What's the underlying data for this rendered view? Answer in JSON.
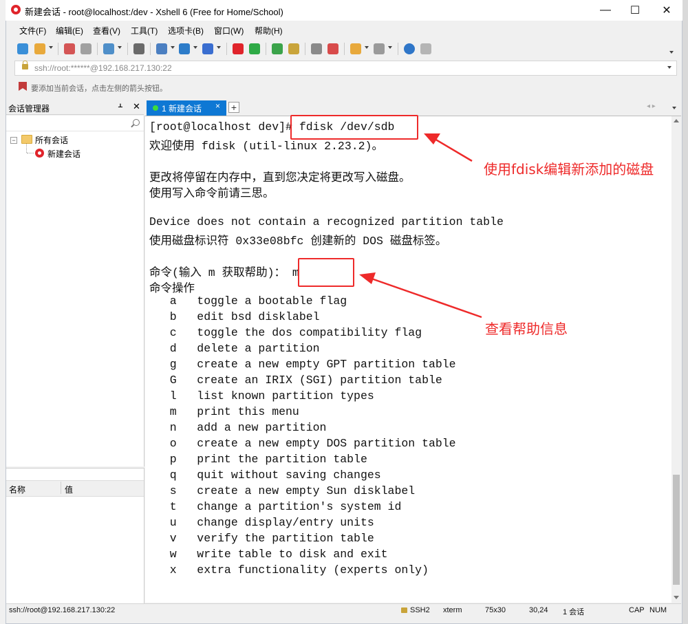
{
  "window": {
    "title": "新建会话 - root@localhost:/dev - Xshell 6 (Free for Home/School)",
    "minimize": "—",
    "maximize": "☐",
    "close": "✕"
  },
  "menu": [
    "文件(F)",
    "编辑(E)",
    "查看(V)",
    "工具(T)",
    "选项卡(B)",
    "窗口(W)",
    "帮助(H)"
  ],
  "toolbar_icons": [
    {
      "name": "new-session-icon",
      "color": "#3a8fd8"
    },
    {
      "name": "open-folder-icon",
      "color": "#e8a93c"
    },
    {
      "name": "connect-icon",
      "color": "#d45555"
    },
    {
      "name": "disconnect-icon",
      "color": "#a0a0a0"
    },
    {
      "name": "properties-icon",
      "color": "#4f8fc9"
    },
    {
      "name": "find-icon",
      "color": "#6a6a6a"
    },
    {
      "name": "transfer-icon",
      "color": "#4b7fc1"
    },
    {
      "name": "globe-icon",
      "color": "#2d7cc9"
    },
    {
      "name": "font-icon",
      "color": "#3a6ed0"
    },
    {
      "name": "xshell-icon",
      "color": "#e0242b"
    },
    {
      "name": "xftp-icon",
      "color": "#2eaa46"
    },
    {
      "name": "fullscreen-icon",
      "color": "#3ba34a"
    },
    {
      "name": "lock-icon",
      "color": "#c9a43a"
    },
    {
      "name": "keyboard-icon",
      "color": "#8a8a8a"
    },
    {
      "name": "highlight-icon",
      "color": "#d84b4b"
    },
    {
      "name": "new-tab-icon",
      "color": "#e8a93c"
    },
    {
      "name": "layout-icon",
      "color": "#9a9a9a"
    },
    {
      "name": "help-icon",
      "color": "#2f76c8"
    },
    {
      "name": "chat-icon",
      "color": "#b5b5b5"
    }
  ],
  "address": {
    "value": "ssh://root:******@192.168.217.130:22"
  },
  "hint": "要添加当前会话，点击左侧的箭头按钮。",
  "session_manager": {
    "title": "会话管理器",
    "pin": "ᚆ",
    "close": "✕",
    "tree_root": "所有会话",
    "tree_expander": "−",
    "tree_child": "新建会话"
  },
  "properties": {
    "col_name": "名称",
    "col_value": "值"
  },
  "tab": {
    "label": "1 新建会话",
    "close": "×",
    "add": "+",
    "nav": "◂ ▸"
  },
  "terminal_lines": [
    "[root@localhost dev]# fdisk /dev/sdb",
    "欢迎使用 fdisk (util-linux 2.23.2)。",
    "",
    "更改将停留在内存中，直到您决定将更改写入磁盘。",
    "使用写入命令前请三思。",
    "",
    "",
    "Device does not contain a recognized partition table",
    "使用磁盘标识符 0x33e08bfc 创建新的 DOS 磁盘标签。",
    "",
    "命令(输入 m 获取帮助)： m",
    "命令操作",
    "   a   toggle a bootable flag",
    "   b   edit bsd disklabel",
    "   c   toggle the dos compatibility flag",
    "   d   delete a partition",
    "   g   create a new empty GPT partition table",
    "   G   create an IRIX (SGI) partition table",
    "   l   list known partition types",
    "   m   print this menu",
    "   n   add a new partition",
    "   o   create a new empty DOS partition table",
    "   p   print the partition table",
    "   q   quit without saving changes",
    "   s   create a new empty Sun disklabel",
    "   t   change a partition's system id",
    "   u   change display/entry units",
    "   v   verify the partition table",
    "   w   write table to disk and exit",
    "   x   extra functionality (experts only)"
  ],
  "annotations": {
    "note1": "使用fdisk编辑新添加的磁盘",
    "note2": "查看帮助信息"
  },
  "status": {
    "connection": "ssh://root@192.168.217.130:22",
    "protocol": "SSH2",
    "term": "xterm",
    "size": "75x30",
    "cursor": "30,24",
    "sessions": "1 会话",
    "caps": "CAP",
    "num": "NUM"
  }
}
